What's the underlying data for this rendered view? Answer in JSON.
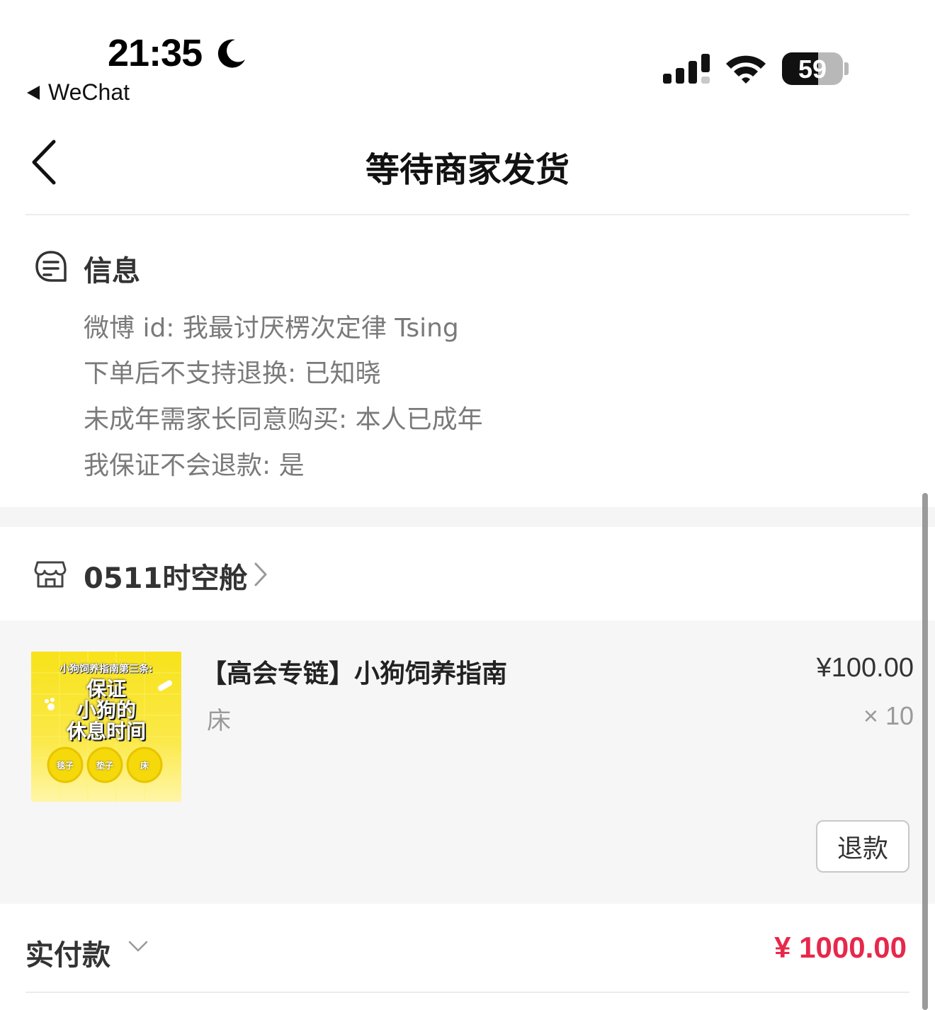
{
  "status_bar": {
    "time": "21:35",
    "back_app_label": "WeChat",
    "battery_level": "59"
  },
  "nav": {
    "title": "等待商家发货"
  },
  "info": {
    "title": "信息",
    "lines": [
      "微博 id: 我最讨厌楞次定律 Tsing",
      "下单后不支持退换: 已知晓",
      "未成年需家长同意购买: 本人已成年",
      "我保证不会退款: 是"
    ]
  },
  "shop": {
    "name": "0511时空舱"
  },
  "product": {
    "title": "【高会专链】小狗饲养指南",
    "price": "¥100.00",
    "variant": "床",
    "quantity": "× 10",
    "refund_label": "退款",
    "thumb_text": {
      "top": "小狗饲养指南第三条:",
      "line1": "保证",
      "line2": "小狗的",
      "line3": "休息时间",
      "circle1": "毯子",
      "circle2": "垫子",
      "circle3": "床"
    }
  },
  "total": {
    "label": "实付款",
    "amount": "¥ 1000.00"
  },
  "colors": {
    "accent_price": "#e8274b",
    "thumb_yellow": "#f7e21a"
  }
}
